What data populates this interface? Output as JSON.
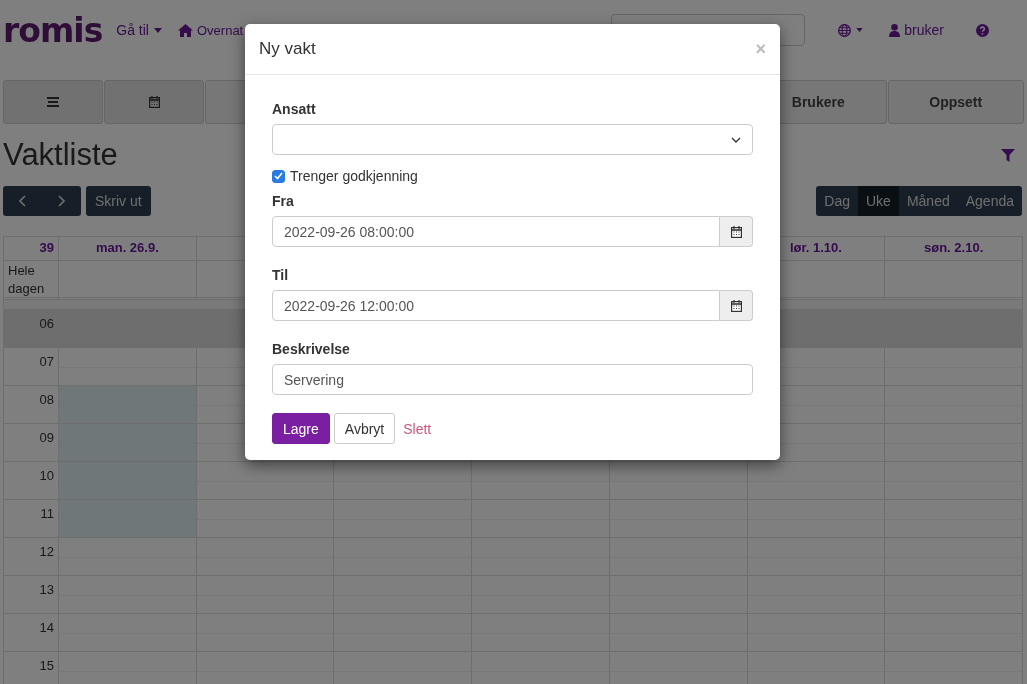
{
  "navbar": {
    "logo": "romis",
    "menu": [
      {
        "label": "Gå til",
        "kind": "dropdown"
      },
      {
        "label": "Overnat",
        "kind": "home"
      }
    ],
    "user": "bruker"
  },
  "tiles": [
    {
      "kind": "menu"
    },
    {
      "kind": "calendar"
    },
    {
      "kind": "hidden"
    },
    {
      "kind": "text",
      "label": "Brukere"
    },
    {
      "kind": "text",
      "label": "Oppsett"
    }
  ],
  "page_title": "Vaktliste",
  "print_button": "Skriv ut",
  "views": [
    {
      "label": "Dag",
      "selected": false
    },
    {
      "label": "Uke",
      "selected": true
    },
    {
      "label": "Måned",
      "selected": false
    },
    {
      "label": "Agenda",
      "selected": false
    }
  ],
  "calendar": {
    "week": "39",
    "all_day": "Hele dagen",
    "days": [
      {
        "label": "man. 26.9."
      },
      {
        "label": "lør. 1.10."
      },
      {
        "label": "søn. 2.10."
      }
    ],
    "hours": [
      {
        "label": "06",
        "shaded": true,
        "selected": false
      },
      {
        "label": "07",
        "shaded": false,
        "selected": false
      },
      {
        "label": "08",
        "shaded": false,
        "selected": true
      },
      {
        "label": "09",
        "shaded": false,
        "selected": true
      },
      {
        "label": "10",
        "shaded": false,
        "selected": true
      },
      {
        "label": "11",
        "shaded": false,
        "selected": true
      },
      {
        "label": "12",
        "shaded": false,
        "selected": false
      },
      {
        "label": "13",
        "shaded": false,
        "selected": false
      },
      {
        "label": "14",
        "shaded": false,
        "selected": false
      },
      {
        "label": "15",
        "shaded": false,
        "selected": false
      }
    ]
  },
  "modal": {
    "title": "Ny vakt",
    "close": "×",
    "employee": {
      "label": "Ansatt"
    },
    "needs_approval": {
      "label": "Trenger godkjenning",
      "checked": true
    },
    "from": {
      "label": "Fra",
      "value": "2022-09-26 08:00:00"
    },
    "to": {
      "label": "Til",
      "value": "2022-09-26 12:00:00"
    },
    "description": {
      "label": "Beskrivelse",
      "value": "Servering"
    },
    "buttons": [
      {
        "label": "Lagre",
        "kind": "primary"
      },
      {
        "label": "Avbryt",
        "kind": "default"
      },
      {
        "label": "Slett",
        "kind": "link"
      }
    ]
  }
}
